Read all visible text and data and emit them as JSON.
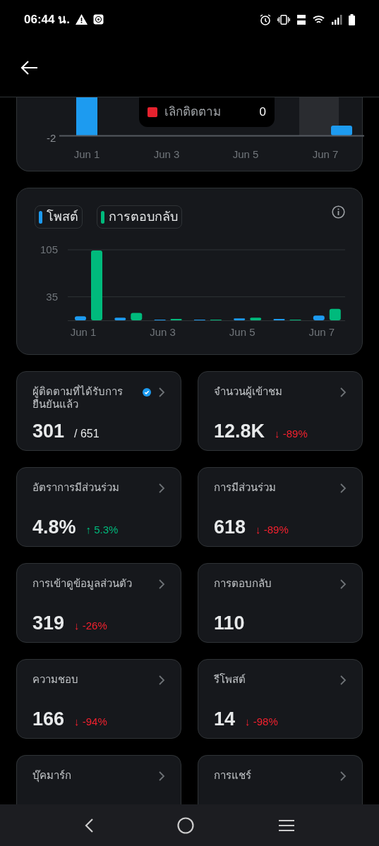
{
  "status_bar": {
    "time": "06:44 น."
  },
  "top_chart": {
    "y_tick": "-2",
    "x_labels": [
      "Jun 1",
      "Jun 3",
      "Jun 5",
      "Jun 7"
    ],
    "tooltip": {
      "label": "เลิกติดตาม",
      "value": "0",
      "color": "#e5222e"
    }
  },
  "activity_chart": {
    "chart_data": {
      "type": "bar",
      "categories": [
        "Jun 1",
        null,
        "Jun 3",
        null,
        "Jun 5",
        null,
        "Jun 7"
      ],
      "ylim": [
        0,
        105
      ],
      "yticks": [
        35,
        105
      ],
      "series": [
        {
          "name": "โพสต์",
          "color": "#1d9bf0",
          "values": [
            6,
            4,
            1,
            1,
            3,
            2,
            7
          ]
        },
        {
          "name": "การตอบกลับ",
          "color": "#00ba7c",
          "values": [
            104,
            11,
            2,
            1,
            4,
            0,
            17
          ]
        }
      ]
    }
  },
  "metrics": [
    {
      "title": "ผู้ติดตามที่ได้รับการยืนยันแล้ว",
      "verified": true,
      "value": "301",
      "total": "/ 651"
    },
    {
      "title": "จำนวนผู้เข้าชม",
      "verified": false,
      "value": "12.8K",
      "change": {
        "negative": true,
        "arrow": "↓",
        "text": "-89%"
      }
    },
    {
      "title": "อัตราการมีส่วนร่วม",
      "verified": false,
      "value": "4.8%",
      "change": {
        "negative": false,
        "arrow": "↑",
        "text": "5.3%"
      }
    },
    {
      "title": "การมีส่วนร่วม",
      "verified": false,
      "value": "618",
      "change": {
        "negative": true,
        "arrow": "↓",
        "text": "-89%"
      }
    },
    {
      "title": "การเข้าดูข้อมูลส่วนตัว",
      "verified": false,
      "value": "319",
      "change": {
        "negative": true,
        "arrow": "↓",
        "text": "-26%"
      }
    },
    {
      "title": "การตอบกลับ",
      "verified": false,
      "value": "110"
    },
    {
      "title": "ความชอบ",
      "verified": false,
      "value": "166",
      "change": {
        "negative": true,
        "arrow": "↓",
        "text": "-94%"
      }
    },
    {
      "title": "รีโพสต์",
      "verified": false,
      "value": "14",
      "change": {
        "negative": true,
        "arrow": "↓",
        "text": "-98%"
      }
    },
    {
      "title": "บุ๊คมาร์ก",
      "verified": false
    },
    {
      "title": "การแชร์",
      "verified": false
    }
  ]
}
